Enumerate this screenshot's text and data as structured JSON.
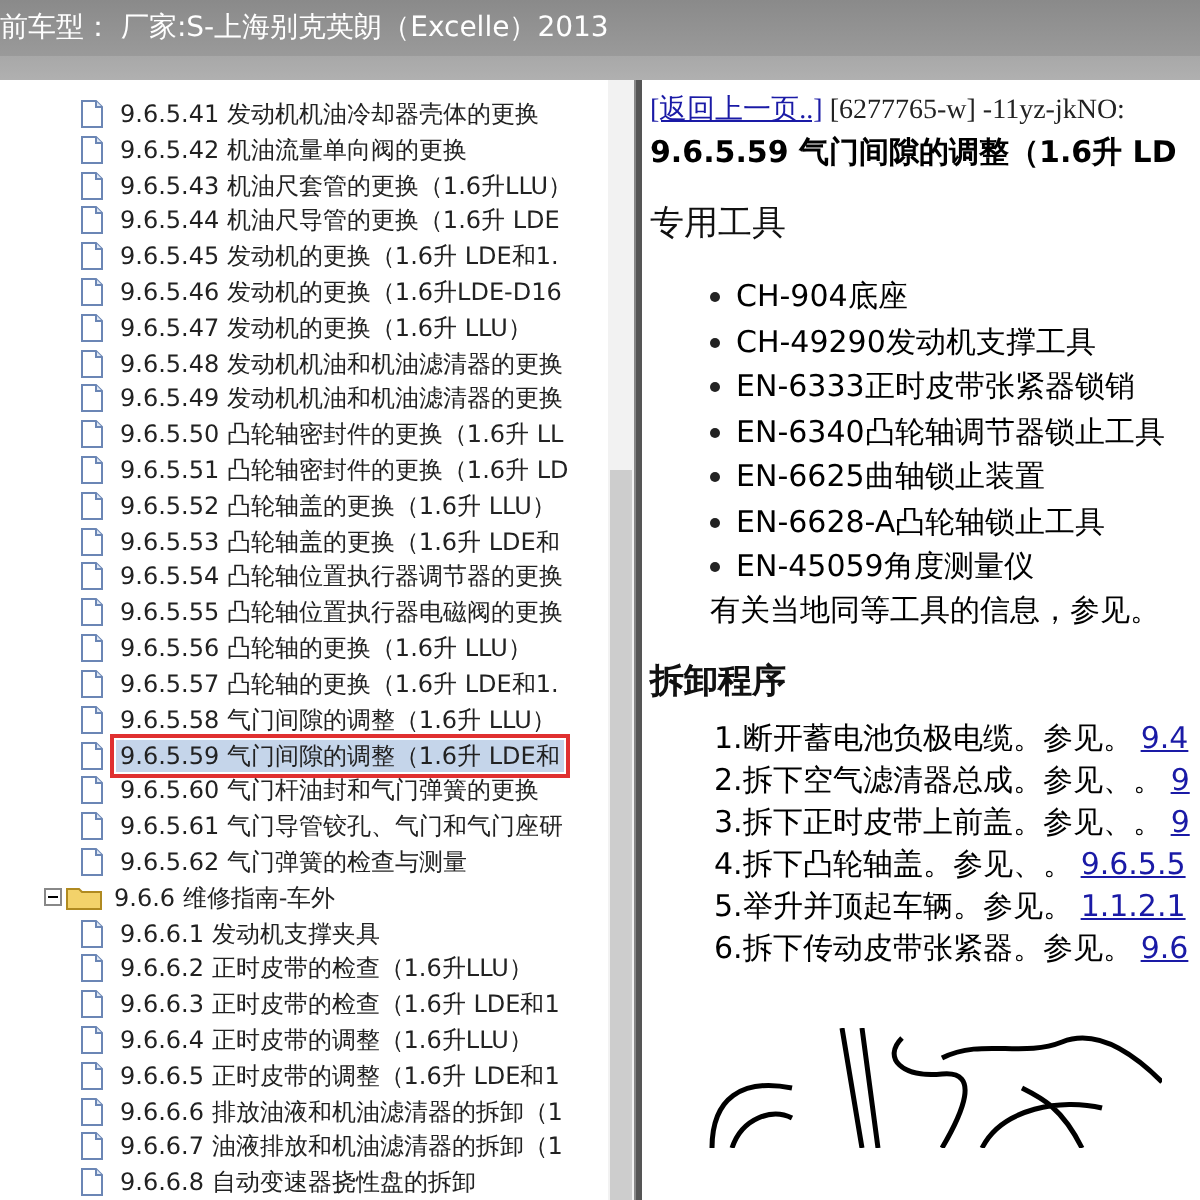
{
  "title_bar": {
    "text": "前车型：  厂家:S-上海别克英朗（Excelle）2013"
  },
  "tree": {
    "continued_children": [
      {
        "label": "9.6.5.41 发动机机油冷却器壳体的更换",
        "selected": false
      },
      {
        "label": "9.6.5.42 机油流量单向阀的更换",
        "selected": false
      },
      {
        "label": "9.6.5.43 机油尺套管的更换（1.6升LLU）",
        "selected": false
      },
      {
        "label": "9.6.5.44 机油尺导管的更换（1.6升 LDE",
        "selected": false
      },
      {
        "label": "9.6.5.45 发动机的更换（1.6升 LDE和1.",
        "selected": false
      },
      {
        "label": "9.6.5.46 发动机的更换（1.6升LDE-D16",
        "selected": false
      },
      {
        "label": "9.6.5.47 发动机的更换（1.6升 LLU）",
        "selected": false
      },
      {
        "label": "9.6.5.48 发动机机油和机油滤清器的更换",
        "selected": false
      },
      {
        "label": "9.6.5.49 发动机机油和机油滤清器的更换",
        "selected": false
      },
      {
        "label": "9.6.5.50 凸轮轴密封件的更换（1.6升 LL",
        "selected": false
      },
      {
        "label": "9.6.5.51 凸轮轴密封件的更换（1.6升 LD",
        "selected": false
      },
      {
        "label": "9.6.5.52 凸轮轴盖的更换（1.6升 LLU）",
        "selected": false
      },
      {
        "label": "9.6.5.53 凸轮轴盖的更换（1.6升 LDE和",
        "selected": false
      },
      {
        "label": "9.6.5.54 凸轮轴位置执行器调节器的更换",
        "selected": false
      },
      {
        "label": "9.6.5.55 凸轮轴位置执行器电磁阀的更换",
        "selected": false
      },
      {
        "label": "9.6.5.56 凸轮轴的更换（1.6升 LLU）",
        "selected": false
      },
      {
        "label": "9.6.5.57 凸轮轴的更换（1.6升 LDE和1.",
        "selected": false
      },
      {
        "label": "9.6.5.58 气门间隙的调整（1.6升 LLU）",
        "selected": false
      },
      {
        "label": "9.6.5.59 气门间隙的调整（1.6升 LDE和",
        "selected": true
      },
      {
        "label": "9.6.5.60 气门杆油封和气门弹簧的更换",
        "selected": false
      },
      {
        "label": "9.6.5.61 气门导管铰孔、气门和气门座研",
        "selected": false
      },
      {
        "label": "9.6.5.62 气门弹簧的检查与测量",
        "selected": false
      }
    ],
    "nodes": [
      {
        "label": "9.6.6 维修指南-车外",
        "selected": false,
        "expanded": true,
        "children": [
          {
            "label": "9.6.6.1 发动机支撑夹具",
            "selected": false
          },
          {
            "label": "9.6.6.2 正时皮带的检查（1.6升LLU）",
            "selected": false
          },
          {
            "label": "9.6.6.3 正时皮带的检查（1.6升 LDE和1",
            "selected": false
          },
          {
            "label": "9.6.6.4 正时皮带的调整（1.6升LLU）",
            "selected": false
          },
          {
            "label": "9.6.6.5 正时皮带的调整（1.6升 LDE和1",
            "selected": false
          },
          {
            "label": "9.6.6.6 排放油液和机油滤清器的拆卸（1",
            "selected": false
          },
          {
            "label": "9.6.6.7 油液排放和机油滤清器的拆卸（1",
            "selected": false
          },
          {
            "label": "9.6.6.8 自动变速器挠性盘的拆卸",
            "selected": false
          }
        ]
      }
    ]
  },
  "document": {
    "back_link": "[返回上一页..]",
    "doc_id": "[6277765-w] -11yz-jkNO:",
    "heading": "9.6.5.59 气门间隙的调整（1.6升 LD",
    "tools_title": "专用工具",
    "tools": [
      "CH-904底座",
      "CH-49290发动机支撑工具",
      "EN-6333正时皮带张紧器锁销",
      "EN-6340凸轮轴调节器锁止工具",
      "EN-6625曲轴锁止装置",
      "EN-6628-A凸轮轴锁止工具",
      "EN-45059角度测量仪"
    ],
    "tools_note": "有关当地同等工具的信息，参见。",
    "procedure_title": "拆卸程序",
    "steps": [
      {
        "text": "1.断开蓄电池负极电缆。参见。",
        "link": "9.4"
      },
      {
        "text": "2.拆下空气滤清器总成。参见、。",
        "link": "9"
      },
      {
        "text": "3.拆下正时皮带上前盖。参见、。",
        "link": "9"
      },
      {
        "text": "4.拆下凸轮轴盖。参见、。",
        "link": "9.6.5.5"
      },
      {
        "text": "5.举升并顶起车辆。参见。",
        "link": "1.1.2.1"
      },
      {
        "text": "6.拆下传动皮带张紧器。参见。",
        "link": "9.6"
      }
    ]
  }
}
